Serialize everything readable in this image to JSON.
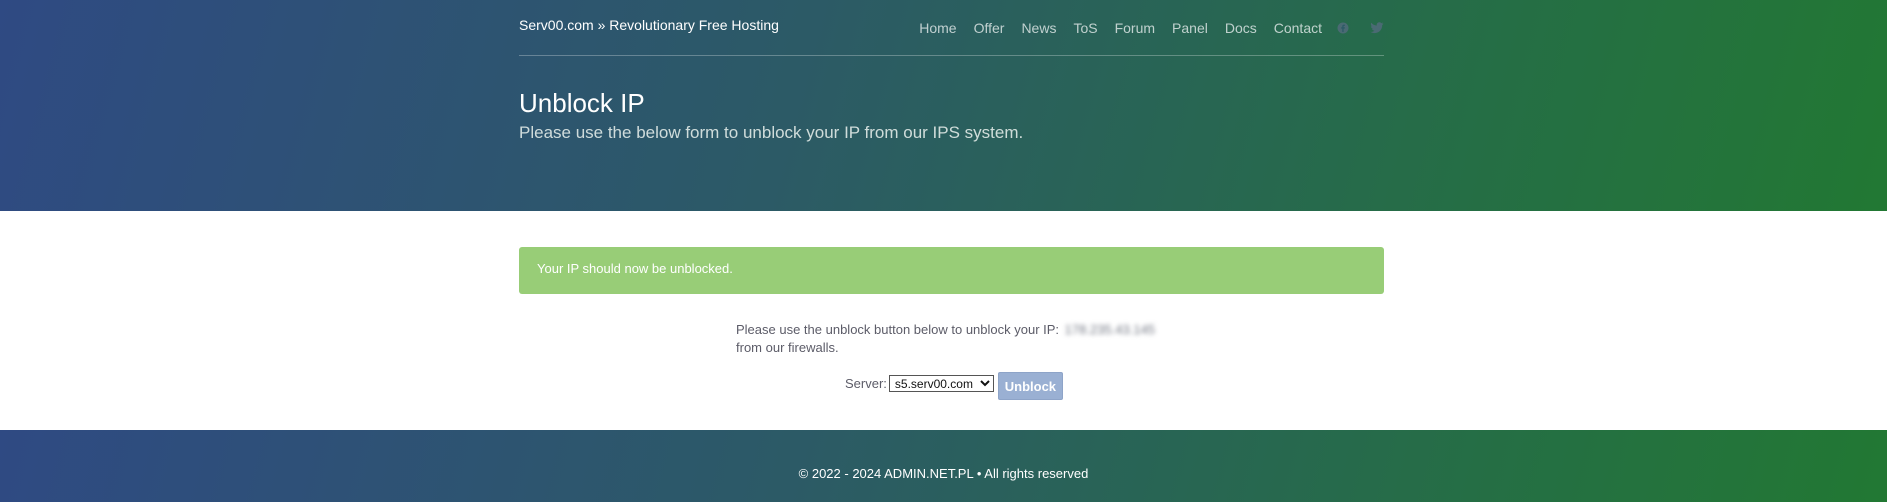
{
  "header": {
    "brand": "Serv00.com » Revolutionary Free Hosting",
    "nav": [
      {
        "label": "Home"
      },
      {
        "label": "Offer"
      },
      {
        "label": "News"
      },
      {
        "label": "ToS"
      },
      {
        "label": "Forum"
      },
      {
        "label": "Panel"
      },
      {
        "label": "Docs"
      },
      {
        "label": "Contact"
      }
    ],
    "social_icons": [
      "facebook-icon",
      "twitter-icon"
    ]
  },
  "hero": {
    "title": "Unblock IP",
    "subtitle": "Please use the below form to unblock your IP from our IPS system."
  },
  "alert": {
    "message": "Your IP should now be unblocked.",
    "color": "#98cd77"
  },
  "form": {
    "text_before_ip": "Please use the unblock button below to unblock your IP:",
    "ip_redacted": "178.235.43.145",
    "text_after_ip": "from our firewalls.",
    "server_label": "Server:",
    "server_selected": "s5.serv00.com",
    "unblock_label": "Unblock"
  },
  "footer": {
    "copyright": "© 2022 - 2024 ADMIN.NET.PL • All rights reserved"
  },
  "colors": {
    "gradient_start": "#2f4a83",
    "gradient_end": "#227833",
    "button": "#9ab0d3"
  }
}
